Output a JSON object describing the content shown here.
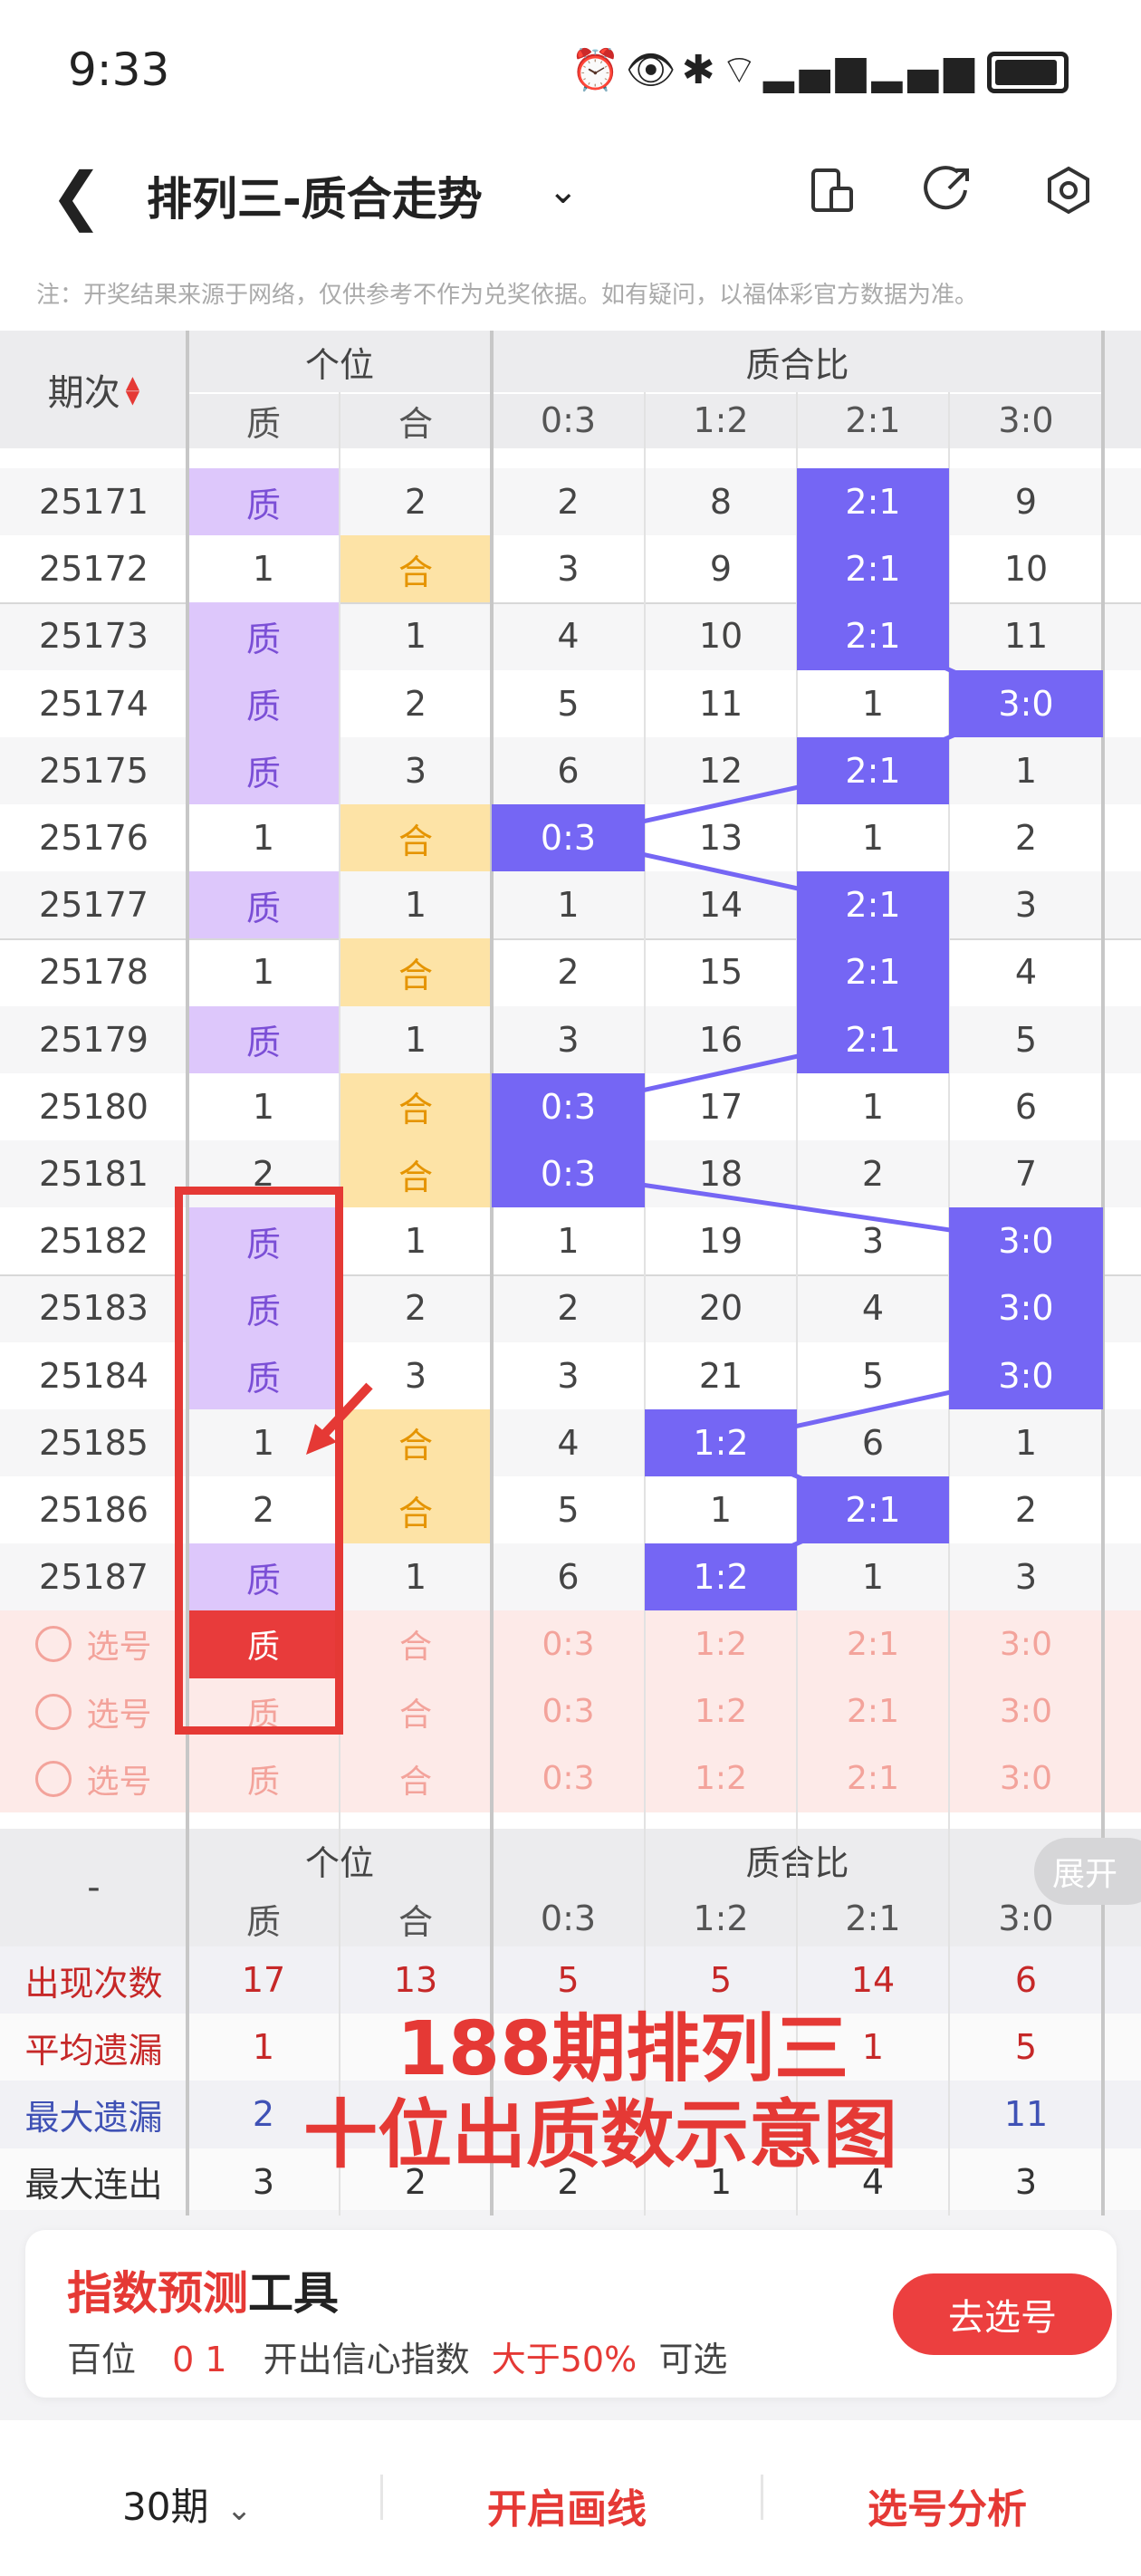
{
  "status": {
    "time": "9:33"
  },
  "header": {
    "title": "排列三-质合走势"
  },
  "notice": "注：开奖结果来源于网络，仅供参考不作为兑奖依据。如有疑问，以福体彩官方数据为准。",
  "table": {
    "col_period": "期次",
    "group_gewei": "个位",
    "group_ratio": "质合比",
    "sub_headers": [
      "质",
      "合",
      "0:3",
      "1:2",
      "2:1",
      "3:0"
    ],
    "rows": [
      {
        "period": "25171",
        "zhi": "质",
        "he": "2",
        "r03": "2",
        "r12": "8",
        "r21": "2:1",
        "r30": "9",
        "win": "zhi",
        "hit": "r21"
      },
      {
        "period": "25172",
        "zhi": "1",
        "he": "合",
        "r03": "3",
        "r12": "9",
        "r21": "2:1",
        "r30": "10",
        "win": "he",
        "hit": "r21"
      },
      {
        "period": "25173",
        "zhi": "质",
        "he": "1",
        "r03": "4",
        "r12": "10",
        "r21": "2:1",
        "r30": "11",
        "win": "zhi",
        "hit": "r21"
      },
      {
        "period": "25174",
        "zhi": "质",
        "he": "2",
        "r03": "5",
        "r12": "11",
        "r21": "1",
        "r30": "3:0",
        "win": "zhi",
        "hit": "r30"
      },
      {
        "period": "25175",
        "zhi": "质",
        "he": "3",
        "r03": "6",
        "r12": "12",
        "r21": "2:1",
        "r30": "1",
        "win": "zhi",
        "hit": "r21"
      },
      {
        "period": "25176",
        "zhi": "1",
        "he": "合",
        "r03": "0:3",
        "r12": "13",
        "r21": "1",
        "r30": "2",
        "win": "he",
        "hit": "r03"
      },
      {
        "period": "25177",
        "zhi": "质",
        "he": "1",
        "r03": "1",
        "r12": "14",
        "r21": "2:1",
        "r30": "3",
        "win": "zhi",
        "hit": "r21"
      },
      {
        "period": "25178",
        "zhi": "1",
        "he": "合",
        "r03": "2",
        "r12": "15",
        "r21": "2:1",
        "r30": "4",
        "win": "he",
        "hit": "r21"
      },
      {
        "period": "25179",
        "zhi": "质",
        "he": "1",
        "r03": "3",
        "r12": "16",
        "r21": "2:1",
        "r30": "5",
        "win": "zhi",
        "hit": "r21"
      },
      {
        "period": "25180",
        "zhi": "1",
        "he": "合",
        "r03": "0:3",
        "r12": "17",
        "r21": "1",
        "r30": "6",
        "win": "he",
        "hit": "r03"
      },
      {
        "period": "25181",
        "zhi": "2",
        "he": "合",
        "r03": "0:3",
        "r12": "18",
        "r21": "2",
        "r30": "7",
        "win": "he",
        "hit": "r03"
      },
      {
        "period": "25182",
        "zhi": "质",
        "he": "1",
        "r03": "1",
        "r12": "19",
        "r21": "3",
        "r30": "3:0",
        "win": "zhi",
        "hit": "r30"
      },
      {
        "period": "25183",
        "zhi": "质",
        "he": "2",
        "r03": "2",
        "r12": "20",
        "r21": "4",
        "r30": "3:0",
        "win": "zhi",
        "hit": "r30"
      },
      {
        "period": "25184",
        "zhi": "质",
        "he": "3",
        "r03": "3",
        "r12": "21",
        "r21": "5",
        "r30": "3:0",
        "win": "zhi",
        "hit": "r30"
      },
      {
        "period": "25185",
        "zhi": "1",
        "he": "合",
        "r03": "4",
        "r12": "1:2",
        "r21": "6",
        "r30": "1",
        "win": "he",
        "hit": "r12"
      },
      {
        "period": "25186",
        "zhi": "2",
        "he": "合",
        "r03": "5",
        "r12": "1",
        "r21": "2:1",
        "r30": "2",
        "win": "he",
        "hit": "r21"
      },
      {
        "period": "25187",
        "zhi": "质",
        "he": "1",
        "r03": "6",
        "r12": "1:2",
        "r21": "1",
        "r30": "3",
        "win": "zhi",
        "hit": "r12"
      }
    ],
    "pick_label": "选号",
    "pick_rows": [
      {
        "selected": "zhi"
      },
      {
        "selected": ""
      },
      {
        "selected": ""
      }
    ],
    "stats_dash": "-",
    "expand_label": "展开",
    "stats": [
      {
        "label": "出现次数",
        "color": "#c62828",
        "values": [
          "17",
          "13",
          "5",
          "5",
          "14",
          "6"
        ]
      },
      {
        "label": "平均遗漏",
        "color": "#c62828",
        "values": [
          "1",
          "",
          "",
          "",
          "1",
          "5"
        ]
      },
      {
        "label": "最大遗漏",
        "color": "#3f51b5",
        "values": [
          "2",
          "",
          "",
          "",
          "",
          "11"
        ]
      },
      {
        "label": "最大连出",
        "color": "#333333",
        "values": [
          "3",
          "2",
          "2",
          "1",
          "4",
          "3"
        ]
      }
    ]
  },
  "annotation": {
    "line1": "188期排列三",
    "line2": "十位出质数示意图"
  },
  "tool_panel": {
    "title_red": "指数预测",
    "title_black": "工具",
    "row_pos": "百位",
    "row_nums": "0 1",
    "row_mid": "开出信心指数",
    "row_pct": "大于50%",
    "row_end": "可选",
    "button": "去选号"
  },
  "bottom": {
    "period_select": "30期",
    "draw_line": "开启画线",
    "analysis": "选号分析"
  },
  "colors": {
    "accent_red": "#ec3f3f",
    "hit_blue": "#7566f4",
    "zhi_purple": "#ddc7fb",
    "he_orange": "#fde3a6",
    "pick_bg": "#fdeae8"
  }
}
